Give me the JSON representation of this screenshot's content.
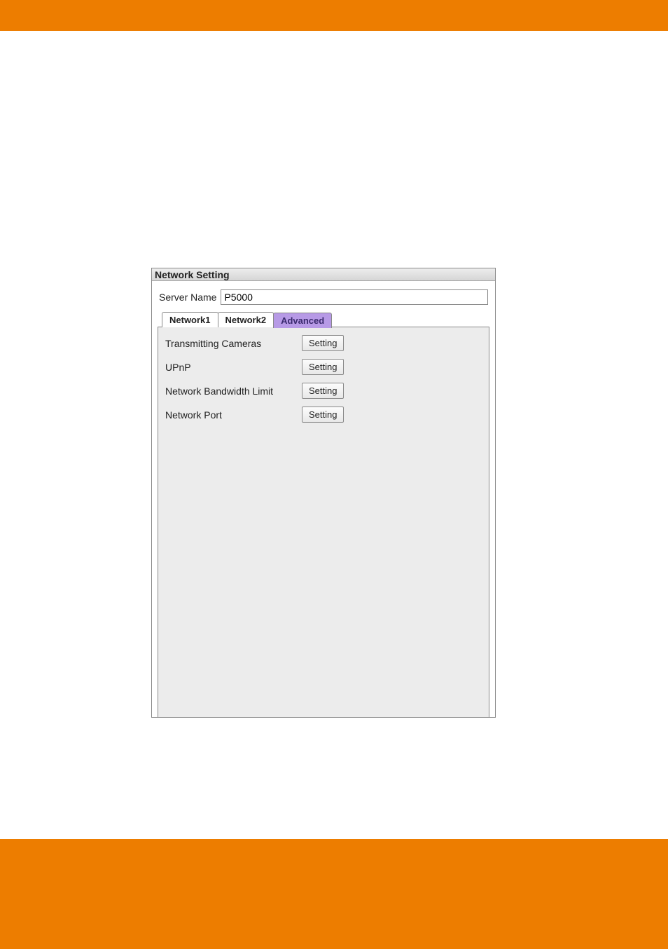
{
  "window": {
    "title": "Network Setting"
  },
  "server": {
    "label": "Server Name",
    "value": "P5000"
  },
  "tabs": [
    {
      "label": "Network1",
      "active": false
    },
    {
      "label": "Network2",
      "active": false
    },
    {
      "label": "Advanced",
      "active": true
    }
  ],
  "settings": [
    {
      "label": "Transmitting Cameras",
      "button": "Setting"
    },
    {
      "label": "UPnP",
      "button": "Setting"
    },
    {
      "label": "Network Bandwidth Limit",
      "button": "Setting"
    },
    {
      "label": "Network Port",
      "button": "Setting"
    }
  ]
}
